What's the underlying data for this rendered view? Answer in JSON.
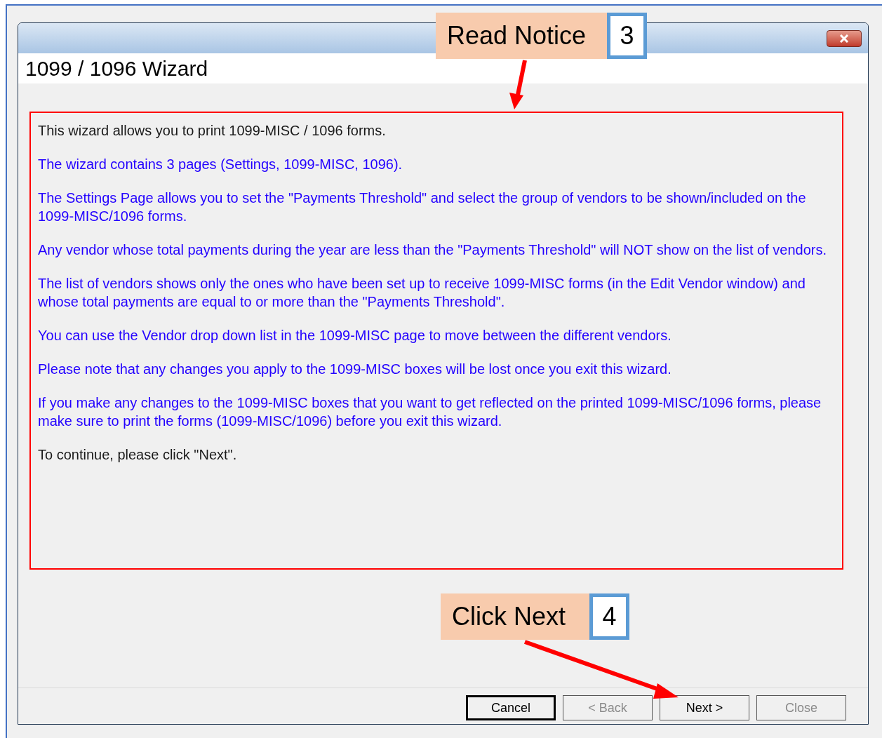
{
  "dialog": {
    "title": "1099 / 1096 Wizard"
  },
  "paragraphs": [
    {
      "kind": "plain",
      "text": "This wizard allows you to print 1099-MISC / 1096 forms."
    },
    {
      "kind": "info",
      "text": "The wizard contains 3 pages (Settings, 1099-MISC, 1096)."
    },
    {
      "kind": "info",
      "text": "The Settings Page allows you to set the \"Payments Threshold\" and select the group of vendors to be shown/included on the 1099-MISC/1096 forms."
    },
    {
      "kind": "info",
      "text": "Any vendor whose total payments during the year are less than the \"Payments Threshold\" will NOT show on the list of vendors."
    },
    {
      "kind": "info",
      "text": "The list of vendors shows only the ones who have been set up to receive 1099-MISC forms (in the Edit Vendor window) and whose total payments are equal to or more than the \"Payments Threshold\"."
    },
    {
      "kind": "info",
      "text": "You can use the Vendor drop down list in the 1099-MISC page to move between the different vendors."
    },
    {
      "kind": "info",
      "text": "Please note that any changes you apply to the 1099-MISC boxes will be lost once you exit this wizard."
    },
    {
      "kind": "info",
      "text": "If you make any changes to the 1099-MISC boxes that you want to get reflected on the printed 1099-MISC/1096 forms, please make sure to print the forms (1099-MISC/1096) before you exit this wizard."
    },
    {
      "kind": "plain",
      "text": "To continue, please click \"Next\"."
    }
  ],
  "buttons": [
    {
      "label": "Cancel",
      "default": true,
      "disabled": false
    },
    {
      "label": "< Back",
      "default": false,
      "disabled": true
    },
    {
      "label": "Next >",
      "default": false,
      "disabled": false
    },
    {
      "label": "Close",
      "default": false,
      "disabled": true
    }
  ],
  "callouts": [
    {
      "label": "Read Notice",
      "number": "3"
    },
    {
      "label": "Click Next",
      "number": "4"
    }
  ]
}
